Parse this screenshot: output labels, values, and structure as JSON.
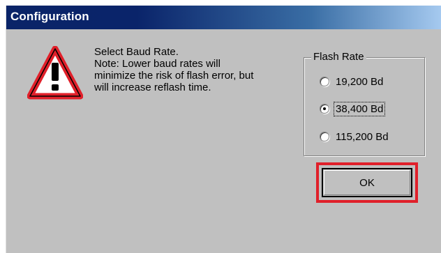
{
  "window": {
    "title": "Configuration"
  },
  "icons": {
    "warning": "warning-triangle-icon"
  },
  "message": {
    "lines": [
      "Select Baud Rate.",
      "Note: Lower baud rates will",
      "minimize the risk of flash error, but",
      "will increase reflash time."
    ]
  },
  "flash_rate": {
    "legend": "Flash Rate",
    "options": [
      {
        "label": "19,200 Bd",
        "selected": false
      },
      {
        "label": "38,400 Bd",
        "selected": true
      },
      {
        "label": "115,200 Bd",
        "selected": false
      }
    ]
  },
  "buttons": {
    "ok_label": "OK"
  },
  "colors": {
    "dialog_bg": "#c0c0c0",
    "titlebar": "#0a246a",
    "highlight_box": "#e0202a",
    "warning_red": "#e0202a"
  }
}
